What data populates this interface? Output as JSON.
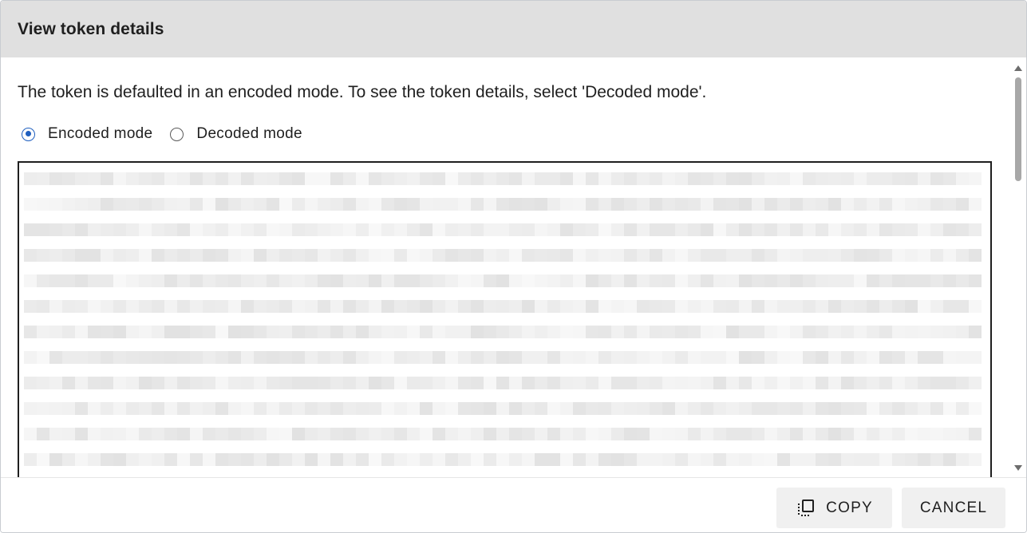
{
  "dialog": {
    "title": "View token details",
    "description": "The token is defaulted in an encoded mode. To see the token details, select 'Decoded mode'.",
    "modes": [
      {
        "label": "Encoded mode",
        "selected": true
      },
      {
        "label": "Decoded mode",
        "selected": false
      }
    ],
    "token": {
      "content_state": "blurred/redacted encoded token text"
    },
    "buttons": {
      "copy_label": "COPY",
      "cancel_label": "CANCEL",
      "copy_icon": "copy-icon"
    }
  },
  "colors": {
    "header_bg": "#e0e0e0",
    "radio_accent": "#1f5fbf",
    "button_bg": "#f0f0f0",
    "token_border": "#1f1f1f"
  }
}
